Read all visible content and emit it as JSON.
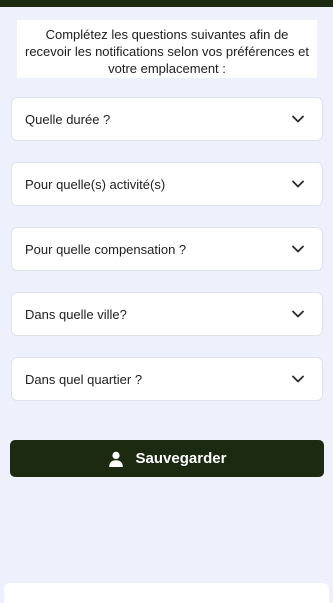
{
  "intro": {
    "text": "Complétez les questions suivantes afin de recevoir les notifications selon vos préférences et votre emplacement :"
  },
  "form": {
    "fields": [
      {
        "label": "Quelle durée ?",
        "icon": "chevron-down-icon"
      },
      {
        "label": "Pour quelle(s) activité(s)",
        "icon": "chevron-down-icon"
      },
      {
        "label": "Pour quelle compensation ?",
        "icon": "chevron-down-icon"
      },
      {
        "label": "Dans quelle ville?",
        "icon": "chevron-down-icon"
      },
      {
        "label": "Dans quel quartier ?",
        "icon": "chevron-down-icon"
      }
    ]
  },
  "save_button": {
    "label": "Sauvegarder",
    "icon": "user-icon"
  },
  "colors": {
    "background": "#eef0fb",
    "primary": "#1c2a12",
    "card": "#ffffff"
  }
}
